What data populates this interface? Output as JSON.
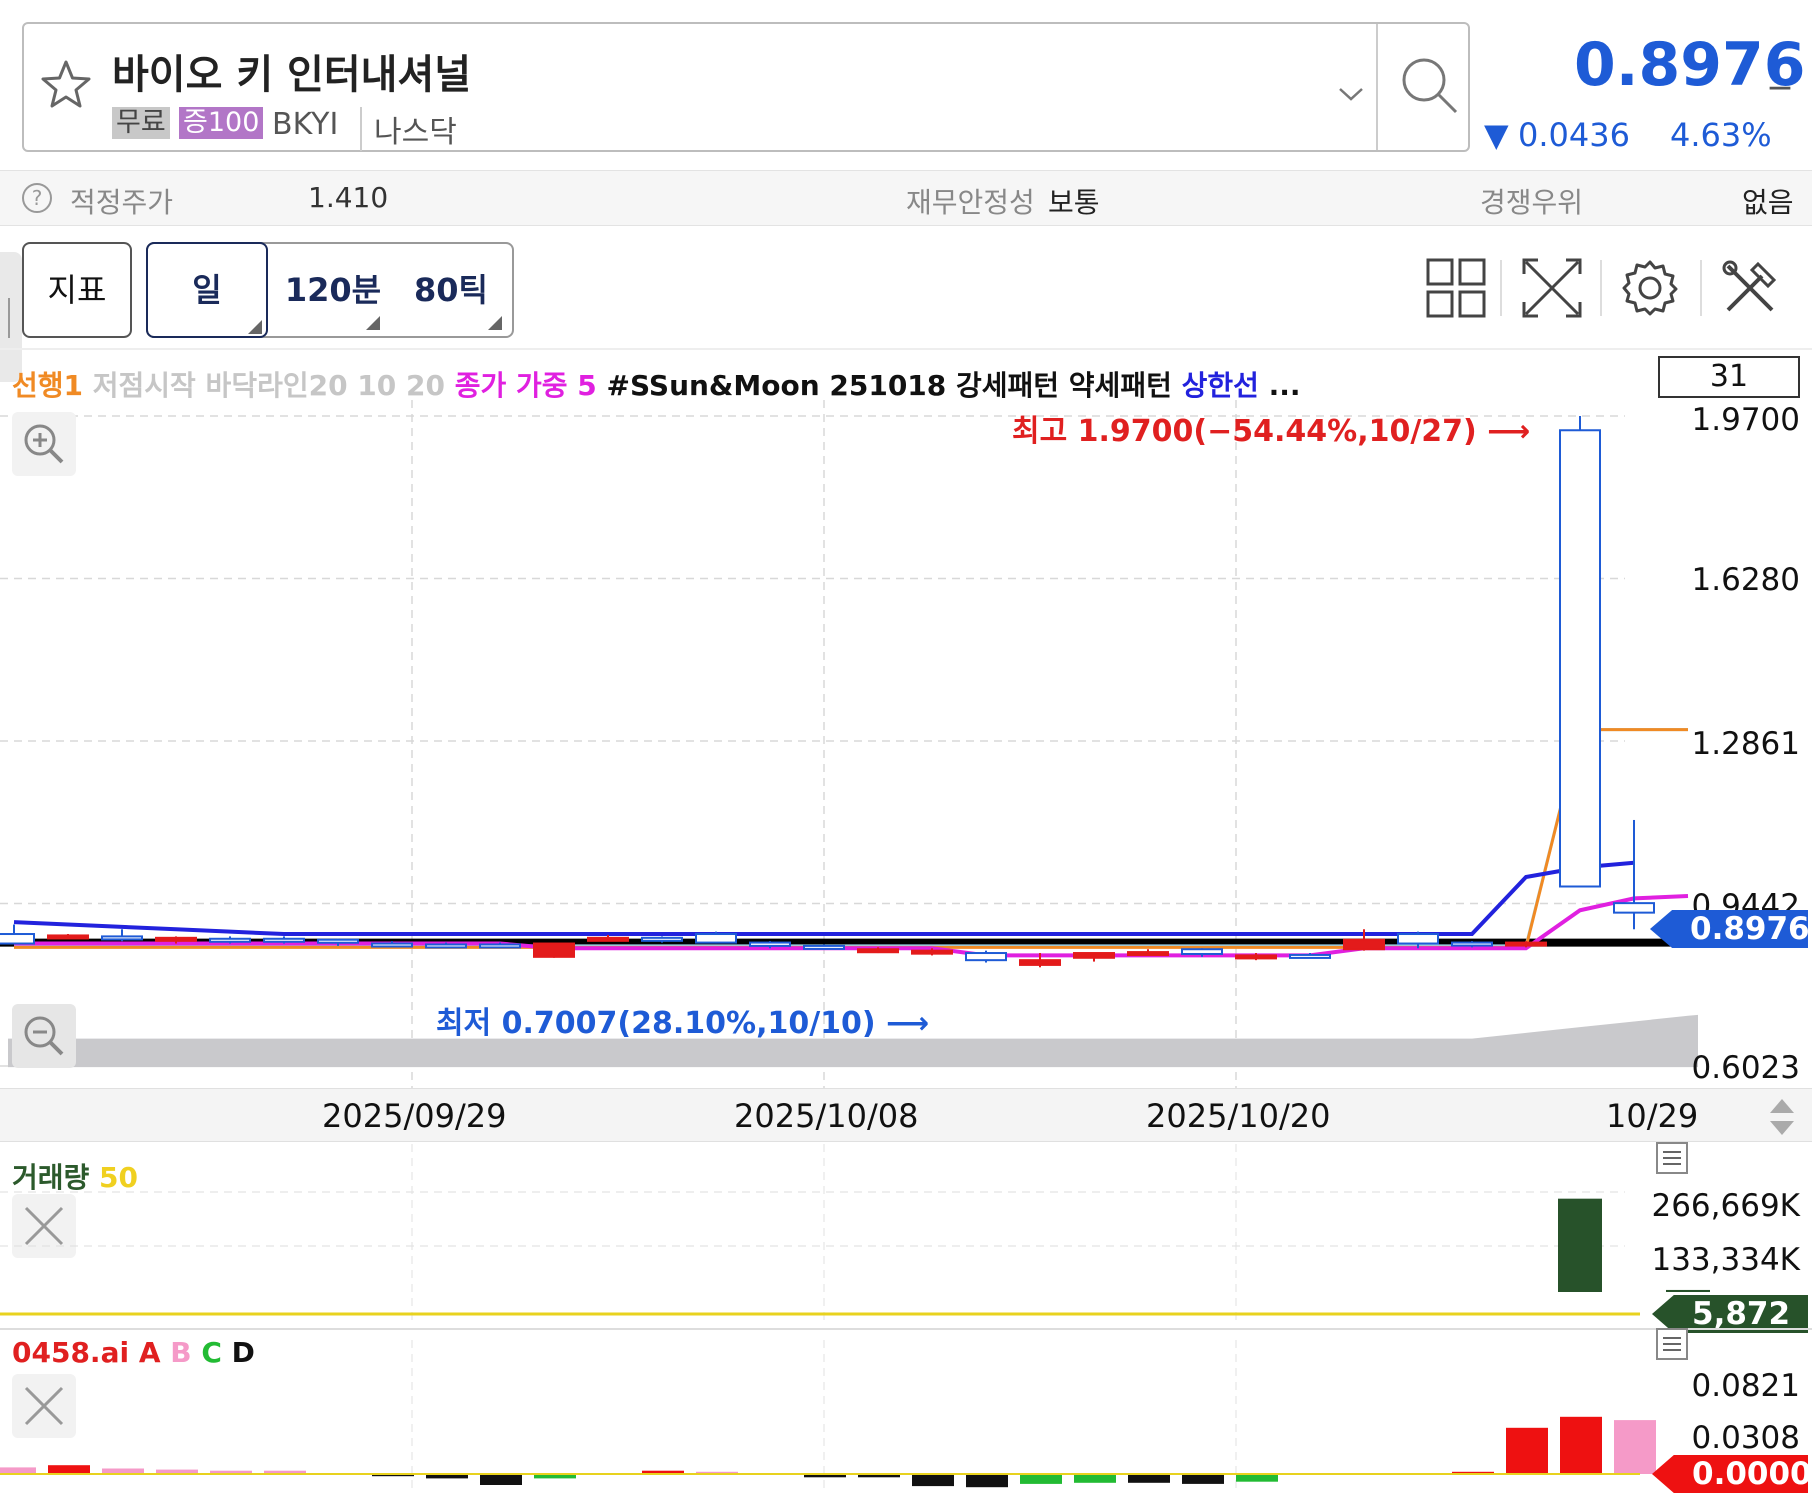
{
  "header": {
    "stock_name": "바이오 키 인터내셔널",
    "tag_free": "무료",
    "tag_margin": "증100",
    "ticker": "BKYI",
    "market": "나스닥",
    "price": "0.8976",
    "price_suffix": "_",
    "change_arrow": "▼",
    "change_value": "0.0436",
    "change_pct": "4.63%",
    "price_color": "#1e5bd6"
  },
  "info": {
    "help": "?",
    "fair_price_label": "적정주가",
    "fair_price_value": "1.410",
    "fin_stability_label": "재무안정성",
    "fin_stability_value": "보통",
    "competitive_label": "경쟁우위",
    "competitive_value": "없음"
  },
  "toolbar": {
    "indicator": "지표",
    "day": "일",
    "min120": "120분",
    "tick80": "80틱",
    "icons": [
      "grid-icon",
      "fullscreen-icon",
      "gear-icon",
      "tools-icon"
    ]
  },
  "legend": {
    "item1": "선행1",
    "item2": "저점시작 바닥라인20 10 20",
    "item3": "종가 가중 5",
    "item4": "#SSun&Moon 251018 강세패턴 약세패턴",
    "item5": "상한선",
    "more": "...",
    "period_box": "31"
  },
  "chart_data": {
    "type": "candlestick",
    "y_ticks": [
      "1.9700",
      "1.6280",
      "1.2861",
      "0.9442",
      "0.6023"
    ],
    "x_ticks": [
      "2025/09/29",
      "2025/10/08",
      "2025/10/20",
      "10/29"
    ],
    "high_annotation": "최고 1.9700(−54.44%,10/27)",
    "low_annotation": "최저 0.7007(28.10%,10/10)",
    "current_price_tag": "0.8976",
    "candles": [
      {
        "o": 0.88,
        "h": 0.9,
        "l": 0.86,
        "c": 0.86,
        "dir": "down"
      },
      {
        "o": 0.875,
        "h": 0.88,
        "l": 0.87,
        "c": 0.877,
        "dir": "up"
      },
      {
        "o": 0.875,
        "h": 0.89,
        "l": 0.865,
        "c": 0.872,
        "dir": "down"
      },
      {
        "o": 0.87,
        "h": 0.875,
        "l": 0.86,
        "c": 0.872,
        "dir": "up"
      },
      {
        "o": 0.87,
        "h": 0.875,
        "l": 0.86,
        "c": 0.868,
        "dir": "down"
      },
      {
        "o": 0.868,
        "h": 0.875,
        "l": 0.86,
        "c": 0.87,
        "dir": "down"
      },
      {
        "o": 0.862,
        "h": 0.87,
        "l": 0.855,
        "c": 0.868,
        "dir": "down"
      },
      {
        "o": 0.86,
        "h": 0.865,
        "l": 0.855,
        "c": 0.858,
        "dir": "down"
      },
      {
        "o": 0.858,
        "h": 0.862,
        "l": 0.85,
        "c": 0.855,
        "dir": "down"
      },
      {
        "o": 0.858,
        "h": 0.862,
        "l": 0.85,
        "c": 0.855,
        "dir": "down"
      },
      {
        "o": 0.86,
        "h": 0.86,
        "l": 0.83,
        "c": 0.832,
        "dir": "up"
      },
      {
        "o": 0.872,
        "h": 0.878,
        "l": 0.865,
        "c": 0.868,
        "dir": "up"
      },
      {
        "o": 0.868,
        "h": 0.875,
        "l": 0.862,
        "c": 0.872,
        "dir": "down"
      },
      {
        "o": 0.862,
        "h": 0.885,
        "l": 0.86,
        "c": 0.88,
        "dir": "down"
      },
      {
        "o": 0.855,
        "h": 0.865,
        "l": 0.85,
        "c": 0.862,
        "dir": "down"
      },
      {
        "o": 0.853,
        "h": 0.858,
        "l": 0.848,
        "c": 0.855,
        "dir": "down"
      },
      {
        "o": 0.848,
        "h": 0.852,
        "l": 0.84,
        "c": 0.845,
        "dir": "up"
      },
      {
        "o": 0.845,
        "h": 0.85,
        "l": 0.835,
        "c": 0.843,
        "dir": "up"
      },
      {
        "o": 0.84,
        "h": 0.845,
        "l": 0.82,
        "c": 0.825,
        "dir": "down"
      },
      {
        "o": 0.825,
        "h": 0.84,
        "l": 0.81,
        "c": 0.815,
        "dir": "up"
      },
      {
        "o": 0.83,
        "h": 0.84,
        "l": 0.822,
        "c": 0.84,
        "dir": "up"
      },
      {
        "o": 0.842,
        "h": 0.848,
        "l": 0.835,
        "c": 0.84,
        "dir": "up"
      },
      {
        "o": 0.838,
        "h": 0.85,
        "l": 0.832,
        "c": 0.848,
        "dir": "down"
      },
      {
        "o": 0.835,
        "h": 0.84,
        "l": 0.825,
        "c": 0.832,
        "dir": "up"
      },
      {
        "o": 0.835,
        "h": 0.84,
        "l": 0.832,
        "c": 0.836,
        "dir": "down"
      },
      {
        "o": 0.868,
        "h": 0.89,
        "l": 0.845,
        "c": 0.848,
        "dir": "up"
      },
      {
        "o": 0.88,
        "h": 0.885,
        "l": 0.85,
        "c": 0.86,
        "dir": "down"
      },
      {
        "o": 0.862,
        "h": 0.865,
        "l": 0.852,
        "c": 0.858,
        "dir": "down"
      },
      {
        "o": 0.862,
        "h": 0.865,
        "l": 0.852,
        "c": 0.858,
        "dir": "up"
      },
      {
        "o": 1.94,
        "h": 1.97,
        "l": 0.98,
        "c": 0.98,
        "dir": "down"
      },
      {
        "o": 0.945,
        "h": 1.12,
        "l": 0.89,
        "c": 0.925,
        "dir": "down"
      },
      {
        "o": 0.915,
        "h": 0.915,
        "l": 0.8976,
        "c": 0.8976,
        "dir": "down"
      }
    ]
  },
  "volume": {
    "title": "거래량",
    "title_suffix": "50",
    "ticks": [
      "266,669K",
      "133,334K"
    ],
    "last_tag": "5,872",
    "bars": [
      0,
      0,
      0,
      0,
      0,
      0,
      0,
      0,
      0,
      0,
      0,
      0,
      0,
      0,
      0,
      0,
      0,
      0,
      0,
      0,
      0,
      0,
      0,
      0,
      0,
      0,
      0,
      0,
      0,
      266669,
      2000,
      5872
    ]
  },
  "ai": {
    "title": "0458.ai",
    "a": "A",
    "b": "B",
    "c": "C",
    "d": "D",
    "ticks": [
      "0.0821",
      "0.0308"
    ],
    "last_tag": "0.0000",
    "bars": [
      {
        "v": 0.006,
        "c": "pink"
      },
      {
        "v": 0.008,
        "c": "red"
      },
      {
        "v": 0.005,
        "c": "pink"
      },
      {
        "v": 0.004,
        "c": "pink"
      },
      {
        "v": 0.003,
        "c": "pink"
      },
      {
        "v": 0.003,
        "c": "pink"
      },
      {
        "v": 0.0,
        "c": "pink"
      },
      {
        "v": -0.002,
        "c": "black"
      },
      {
        "v": -0.004,
        "c": "black"
      },
      {
        "v": -0.01,
        "c": "black"
      },
      {
        "v": -0.004,
        "c": "green"
      },
      {
        "v": 0.0,
        "c": "pink"
      },
      {
        "v": 0.003,
        "c": "red"
      },
      {
        "v": 0.002,
        "c": "pink"
      },
      {
        "v": 0.0,
        "c": "pink"
      },
      {
        "v": -0.003,
        "c": "black"
      },
      {
        "v": -0.003,
        "c": "black"
      },
      {
        "v": -0.011,
        "c": "black"
      },
      {
        "v": -0.012,
        "c": "black"
      },
      {
        "v": -0.009,
        "c": "green"
      },
      {
        "v": -0.008,
        "c": "green"
      },
      {
        "v": -0.008,
        "c": "black"
      },
      {
        "v": -0.009,
        "c": "black"
      },
      {
        "v": -0.007,
        "c": "green"
      },
      {
        "v": 0.0,
        "c": "pink"
      },
      {
        "v": 0.0,
        "c": "pink"
      },
      {
        "v": 0.0,
        "c": "pink"
      },
      {
        "v": 0.002,
        "c": "red"
      },
      {
        "v": 0.042,
        "c": "red"
      },
      {
        "v": 0.052,
        "c": "red"
      },
      {
        "v": 0.049,
        "c": "pink"
      }
    ]
  }
}
